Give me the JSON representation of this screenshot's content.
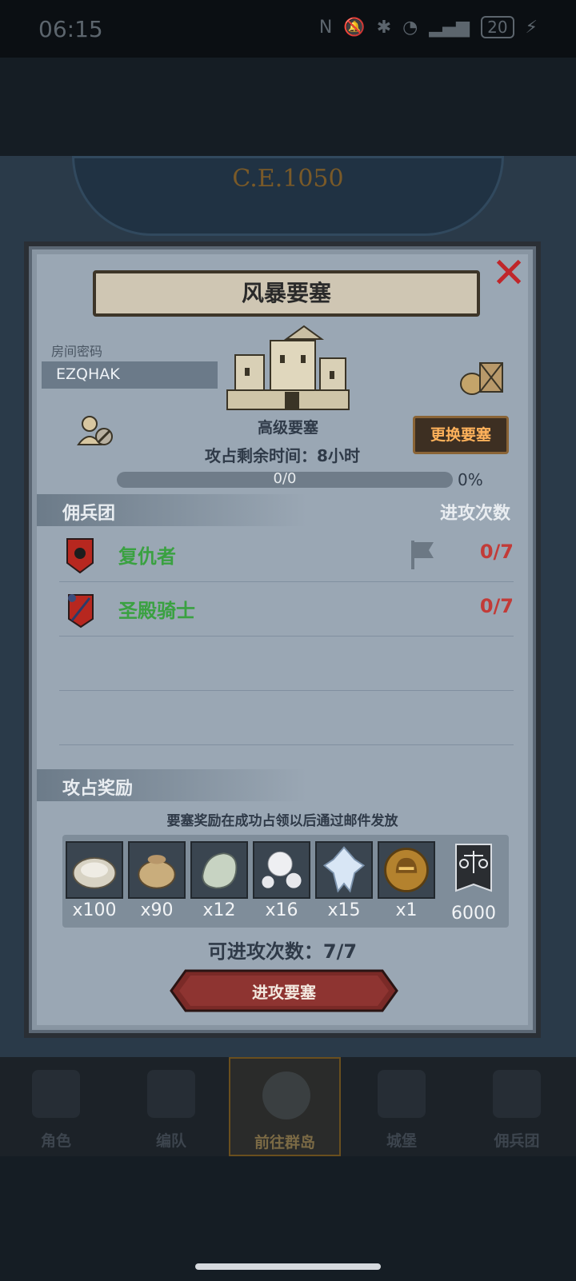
{
  "status_bar": {
    "time": "06:15",
    "battery": "20"
  },
  "map": {
    "era": "C.E.1050"
  },
  "dialog": {
    "title": "风暴要塞",
    "room_code_label": "房间密码",
    "room_code": "EZQHAK",
    "fortress_level": "高级要塞",
    "change_button": "更换要塞",
    "time_left_label": "攻占剩余时间：",
    "time_left_value": "8小时",
    "progress_text": "0/0",
    "progress_percent": "0%",
    "progress_fraction": 0,
    "mercenary_header": "佣兵团",
    "attacks_header": "进攻次数",
    "mercenaries": [
      {
        "name": "复仇者",
        "count": "0/7"
      },
      {
        "name": "圣殿骑士",
        "count": "0/7"
      }
    ],
    "rewards_header": "攻占奖励",
    "rewards_note": "要塞奖励在成功占领以后通过邮件发放",
    "rewards": [
      {
        "icon": "oyster-icon",
        "qty": "x100"
      },
      {
        "icon": "sack-icon",
        "qty": "x90"
      },
      {
        "icon": "stone-icon",
        "qty": "x12"
      },
      {
        "icon": "pearl-icon",
        "qty": "x16"
      },
      {
        "icon": "crystal-icon",
        "qty": "x15"
      },
      {
        "icon": "helmet-medal-icon",
        "qty": "x1"
      },
      {
        "icon": "justice-banner-icon",
        "qty": "6000"
      }
    ],
    "attacks_left_label": "可进攻次数：",
    "attacks_left_value": "7/7",
    "attack_button": "进攻要塞"
  },
  "nav": [
    {
      "label": "角色"
    },
    {
      "label": "编队"
    },
    {
      "label": "前往群岛"
    },
    {
      "label": "城堡"
    },
    {
      "label": "佣兵团"
    }
  ],
  "colors": {
    "accent_green": "#3aa141",
    "count_red": "#c23b38",
    "button_orange": "#ffb25b"
  }
}
